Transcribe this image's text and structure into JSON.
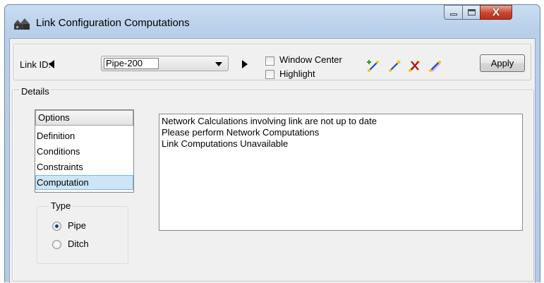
{
  "window": {
    "title": "Link Configuration Computations",
    "close_glyph": "X"
  },
  "toolbar": {
    "link_id_label": "Link ID:",
    "link_id_value": "Pipe-200",
    "window_center_label": "Window Center",
    "highlight_label": "Highlight",
    "window_center_checked": false,
    "highlight_checked": false,
    "tool_icons": [
      "add-link-icon",
      "select-link-icon",
      "delete-link-icon",
      "edit-link-icon"
    ],
    "apply_label": "Apply"
  },
  "details": {
    "legend": "Details",
    "options_header": "Options",
    "options": [
      "Definition",
      "Conditions",
      "Constraints",
      "Computation"
    ],
    "selected_option": "Computation",
    "messages": [
      "Network Calculations involving link are not up to date",
      "Please perform Network Computations",
      "Link Computations Unavailable"
    ],
    "type": {
      "legend": "Type",
      "options": [
        "Pipe",
        "Ditch"
      ],
      "selected": "Pipe"
    }
  },
  "colors": {
    "selection_bg": "#cde6f7",
    "title_gradient": "#c9dcf1",
    "close_button": "#c9452b"
  }
}
